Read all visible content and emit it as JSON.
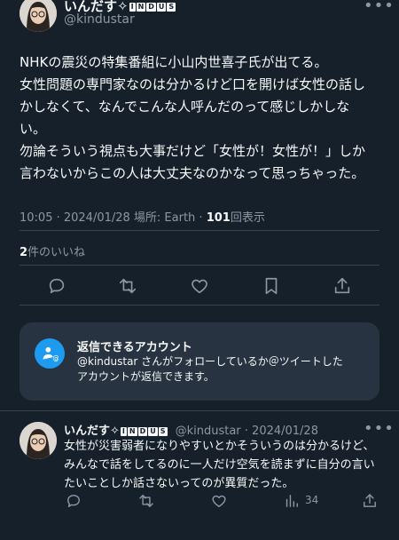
{
  "tweet": {
    "display_name": "いんだす✧",
    "name_badges": [
      "I",
      "N",
      "D",
      "U",
      "S"
    ],
    "handle": "@kindustar",
    "more_icon": "more-horizontal-icon",
    "lines": [
      "NHKの震災の特集番組に小山内世喜子氏が出てる。",
      "女性問題の専門家なのは分かるけど口を開けば女性の話し",
      "かしなくて、なんでこんな人呼んだのって感じしかしな",
      "い。",
      "勿論そういう視点も大事だけど「女性が！女性が！」しか",
      "言わないからこの人は大丈夫なのかなって思っちゃった。"
    ],
    "timestamp": "10:05 · 2024/01/28 場所: Earth · ",
    "view_count": "101",
    "view_label": "回表示",
    "likes_count": "2",
    "likes_label": "件のいいね"
  },
  "actions": {
    "reply": "reply-icon",
    "retweet": "retweet-icon",
    "like": "heart-icon",
    "bookmark": "bookmark-icon",
    "share": "share-icon"
  },
  "notice": {
    "title": "返信できるアカウント",
    "body_line1": "@kindustar さんがフォローしているか＠ツイートした",
    "body_line2": "アカウントが返信できます。",
    "icon": "mention-person-icon"
  },
  "reply": {
    "display_name": "いんだす✧",
    "handle_date": "@kindustar · 2024/01/28",
    "lines": [
      "女性が災害弱者になりやすいとかそういうのは分かるけど、",
      "みんなで話をしてるのに一人だけ空気を読まずに自分の言い",
      "たいことしか話さないってのが異質だった。"
    ],
    "view_count": "34"
  },
  "colors": {
    "background": "#15202b",
    "text": "#f7f9f9",
    "muted": "#8b98a5",
    "accent": "#1d9bf0",
    "card": "#273340"
  }
}
